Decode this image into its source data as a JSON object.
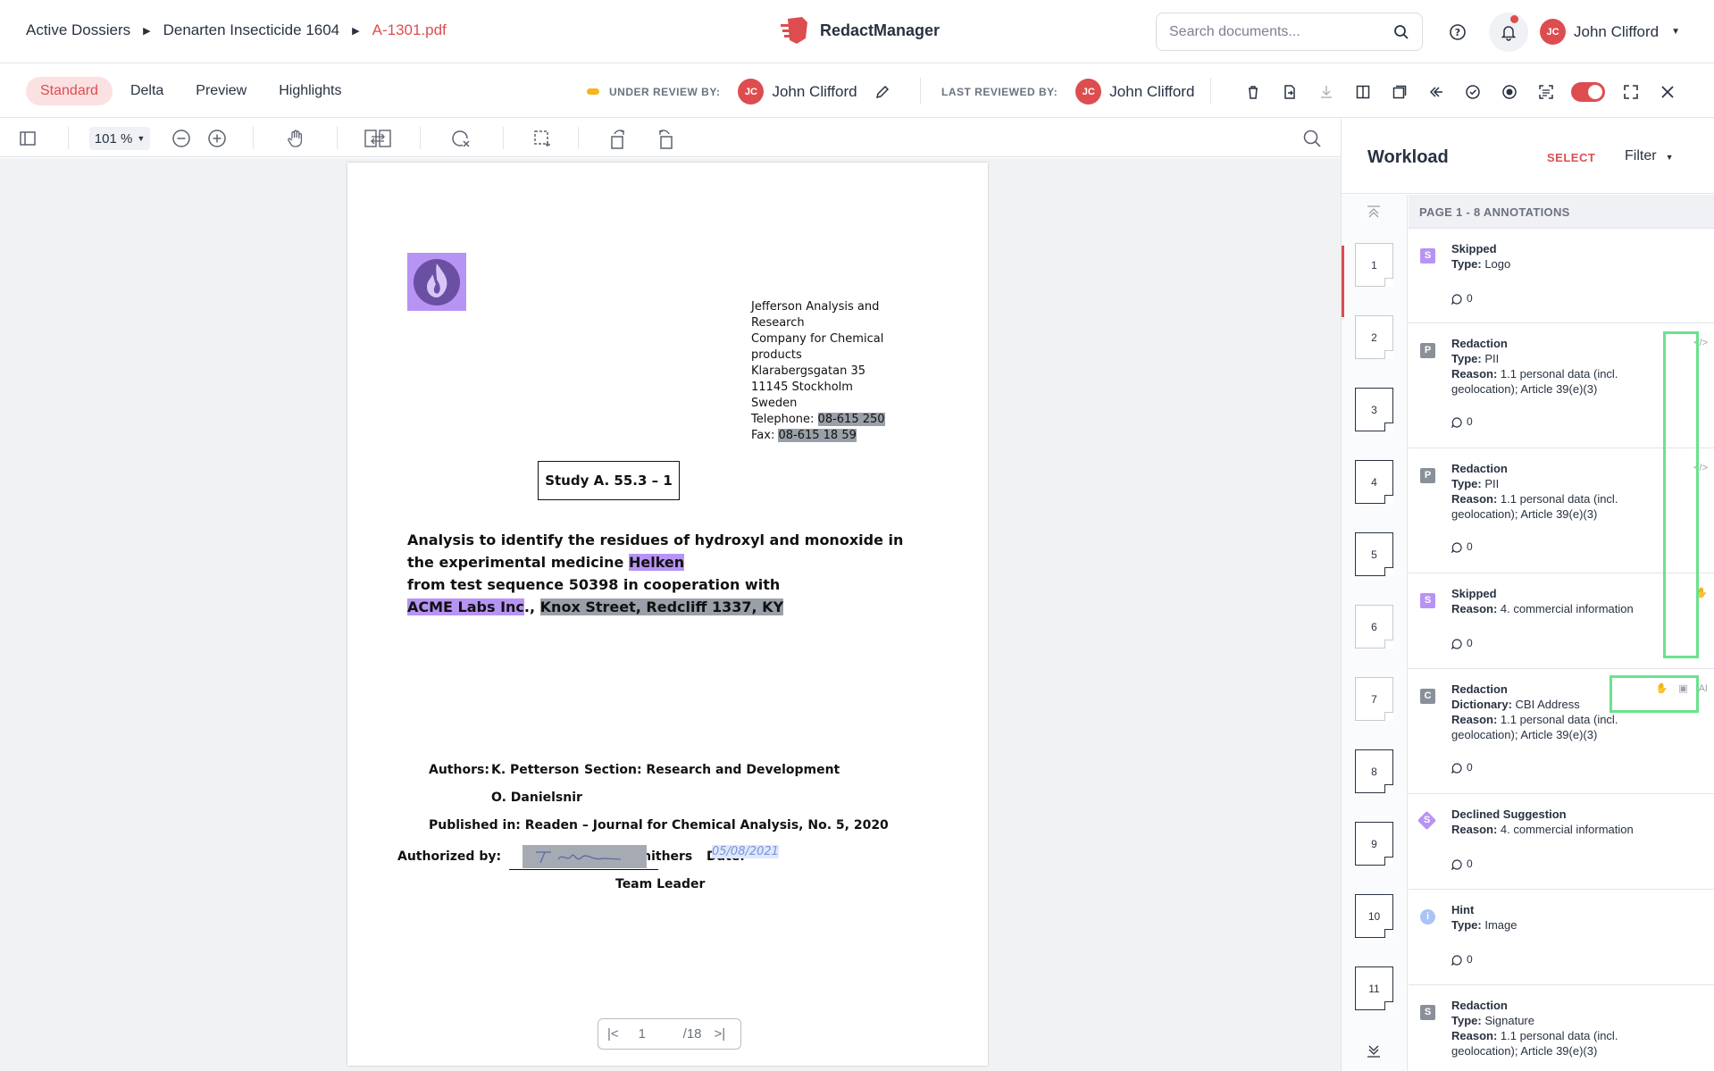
{
  "breadcrumb": {
    "items": [
      "Active Dossiers",
      "Denarten Insecticide 1604",
      "A-1301.pdf"
    ]
  },
  "brand": {
    "name": "RedactManager"
  },
  "search": {
    "placeholder": "Search documents..."
  },
  "user": {
    "initials": "JC",
    "name": "John Clifford"
  },
  "modes": [
    "Standard",
    "Delta",
    "Preview",
    "Highlights"
  ],
  "review": {
    "under_label": "UNDER REVIEW BY:",
    "under_initials": "JC",
    "under_name": "John Clifford",
    "last_label": "LAST REVIEWED BY:",
    "last_initials": "JC",
    "last_name": "John Clifford"
  },
  "viewer": {
    "zoom": "101 %"
  },
  "document": {
    "address_lines": [
      "Jefferson Analysis and Research",
      "Company for Chemical",
      "products",
      "Klarabergsgatan 35",
      "11145 Stockholm",
      "Sweden"
    ],
    "telephone_label": "Telephone: ",
    "telephone": "08-615 250",
    "fax_label": "Fax: ",
    "fax": "08-615 18 59",
    "study": "Study A. 55.3 – 1",
    "title_line1": "Analysis to identify the residues of hydroxyl and monoxide in",
    "title_line2_pre": "the experimental medicine ",
    "title_line2_hl": "Helken",
    "title_line3": "from test sequence 50398 in cooperation with",
    "title_line4_hl1": "ACME Labs Inc",
    "title_line4_sep": ".,",
    "title_line4_hl2": "Knox Street, Redcliff 1337, KY",
    "authors_label": "Authors:",
    "author1": "K. Petterson",
    "author2": "O. Danielsnir",
    "section": "Section: Research and Development",
    "published": "Published in: Readen – Journal for Chemical Analysis, No. 5, 2020",
    "authorized_label": "Authorized by:",
    "authorizer": "J. Smithers",
    "date_label": "Date:",
    "date_value": "05/08/2021",
    "role": "Team Leader"
  },
  "pager": {
    "current": "1",
    "total": "/18"
  },
  "panel": {
    "title": "Workload",
    "select": "SELECT",
    "filter": "Filter",
    "page_header": "PAGE 1 - 8 ANNOTATIONS",
    "thumbs": [
      "1",
      "2",
      "3",
      "4",
      "5",
      "6",
      "7",
      "8",
      "9",
      "10",
      "11"
    ],
    "annotations": [
      {
        "badge": "S",
        "color": "#b794f4",
        "name": "Skipped",
        "l1k": "Type:",
        "l1v": " Logo",
        "l2k": "",
        "l2v": "",
        "comments": "0"
      },
      {
        "badge": "P",
        "color": "#8a9099",
        "name": "Redaction",
        "l1k": "Type:",
        "l1v": " PII",
        "l2k": "Reason:",
        "l2v": " 1.1 personal data (incl. geolocation); Article 39(e)(3)",
        "comments": "0"
      },
      {
        "badge": "P",
        "color": "#8a9099",
        "name": "Redaction",
        "l1k": "Type:",
        "l1v": " PII",
        "l2k": "Reason:",
        "l2v": " 1.1 personal data (incl. geolocation); Article 39(e)(3)",
        "comments": "0"
      },
      {
        "badge": "S",
        "color": "#b794f4",
        "name": "Skipped",
        "l1k": "Reason:",
        "l1v": " 4. commercial information",
        "l2k": "",
        "l2v": "",
        "comments": "0"
      },
      {
        "badge": "C",
        "color": "#8a9099",
        "name": "Redaction",
        "l1k": "Dictionary:",
        "l1v": " CBI Address",
        "l2k": "Reason:",
        "l2v": " 1.1 personal data (incl. geolocation); Article 39(e)(3)",
        "comments": "0"
      },
      {
        "badge": "S",
        "color": "#b794f4",
        "name": "Declined Suggestion",
        "l1k": "Reason:",
        "l1v": " 4. commercial information",
        "l2k": "",
        "l2v": "",
        "comments": "0"
      },
      {
        "badge": "i",
        "color": "#a9c4f5",
        "name": "Hint",
        "l1k": "Type:",
        "l1v": " Image",
        "l2k": "",
        "l2v": "",
        "comments": "0"
      },
      {
        "badge": "S",
        "color": "#8a9099",
        "name": "Redaction",
        "l1k": "Type:",
        "l1v": " Signature",
        "l2k": "Reason:",
        "l2v": " 1.1 personal data (incl. geolocation); Article 39(e)(3)",
        "comments": ""
      }
    ]
  },
  "colors": {
    "accent": "#dd4d50",
    "highlight_purple": "#b794f4",
    "redaction_grey": "#9aa0a9",
    "callout_green": "#6be28e"
  }
}
